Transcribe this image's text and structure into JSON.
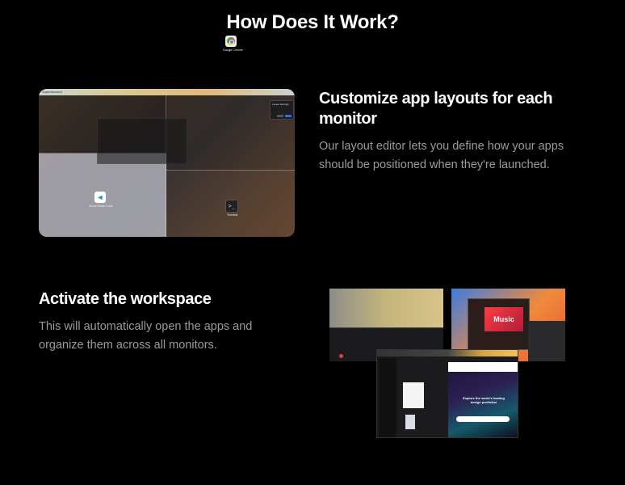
{
  "page": {
    "title": "How Does It Work?"
  },
  "features": [
    {
      "heading": "Customize app layouts for each monitor",
      "body": "Our layout editor lets you define how your apps should be positioned when they're launched."
    },
    {
      "heading": "Activate the workspace",
      "body": "This will automatically open the apps and organize them across all monitors."
    }
  ],
  "editor_screenshot": {
    "menubar_app": "Superfocused",
    "apps": [
      {
        "name": "Google Chrome",
        "icon": "chrome-icon"
      },
      {
        "name": "Visual Studio Code",
        "icon": "vscode-icon"
      },
      {
        "name": "Terminal",
        "icon": "terminal-icon"
      }
    ],
    "popup_title": "Layout Settings"
  },
  "workspace_screenshot": {
    "music_label": "Music",
    "web_title": "Explore the world's leading design portfolios"
  }
}
